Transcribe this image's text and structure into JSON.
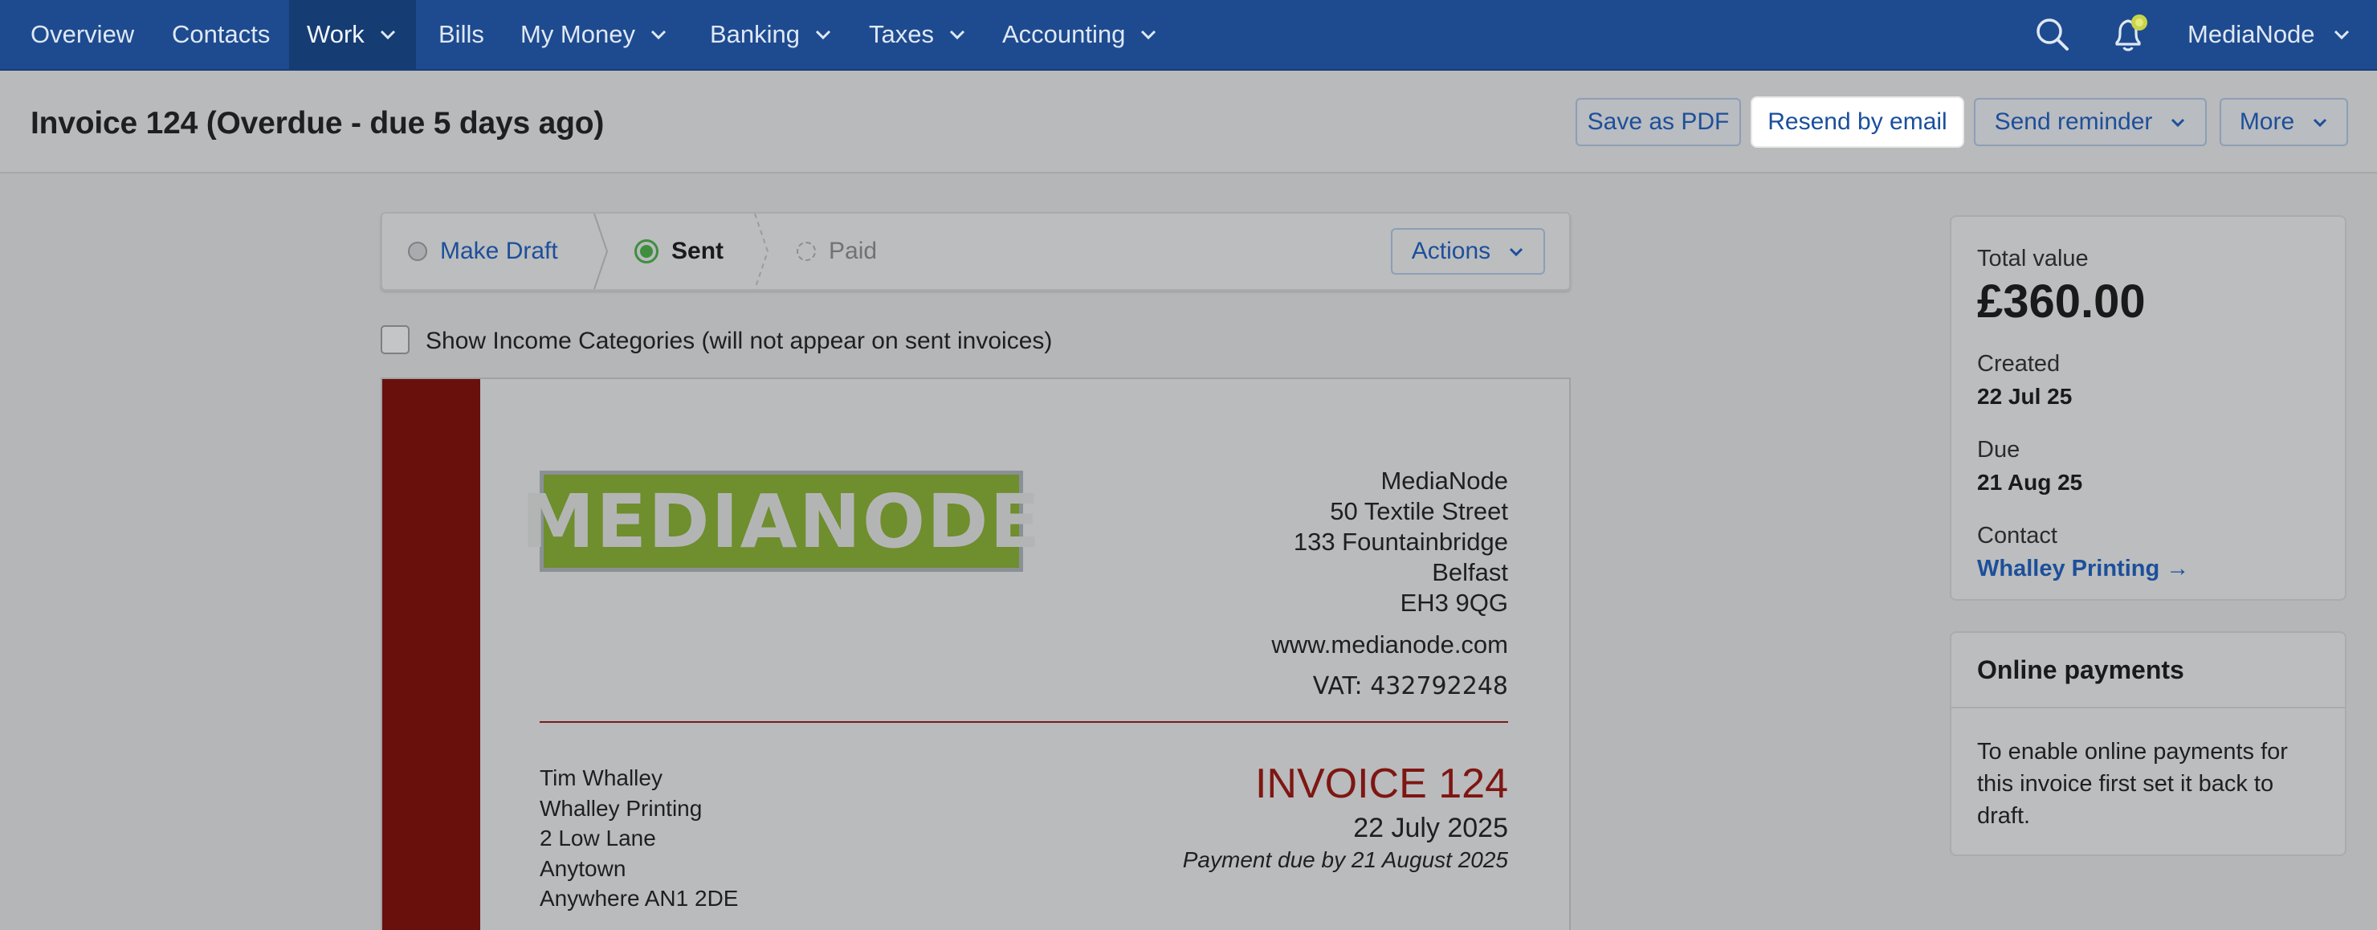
{
  "nav": {
    "items": [
      {
        "label": "Overview"
      },
      {
        "label": "Contacts"
      },
      {
        "label": "Work"
      },
      {
        "label": "Bills"
      },
      {
        "label": "My Money"
      },
      {
        "label": "Banking"
      },
      {
        "label": "Taxes"
      },
      {
        "label": "Accounting"
      }
    ],
    "active": "Work",
    "user": "MediaNode"
  },
  "header": {
    "title": "Invoice 124 (Overdue - due 5 days ago)",
    "buttons": {
      "save_pdf": "Save as PDF",
      "resend": "Resend by email",
      "reminder": "Send reminder",
      "more": "More"
    }
  },
  "status": {
    "steps": {
      "draft": "Make Draft",
      "sent": "Sent",
      "paid": "Paid"
    },
    "actions": "Actions"
  },
  "options": {
    "show_categories": "Show Income Categories (will not appear on sent invoices)"
  },
  "invoice": {
    "logo_text": "MEDIANODE",
    "from": {
      "name": "MediaNode",
      "street": "50 Textile Street",
      "area": "133 Fountainbridge",
      "city": "Belfast",
      "postcode": "EH3 9QG",
      "website": "www.medianode.com",
      "vat": "VAT: 432792248"
    },
    "to": {
      "name": "Tim Whalley",
      "company": "Whalley Printing",
      "street": "2 Low Lane",
      "town": "Anytown",
      "region": "Anywhere AN1 2DE"
    },
    "number": "INVOICE 124",
    "date": "22 July 2025",
    "due": "Payment due by 21 August 2025"
  },
  "summary": {
    "total_label": "Total value",
    "total": "£360.00",
    "created_label": "Created",
    "created": "22 Jul 25",
    "due_label": "Due",
    "due": "21 Aug 25",
    "contact_label": "Contact",
    "contact": "Whalley Printing →"
  },
  "payments": {
    "title": "Online payments",
    "text": "To enable online payments for this invoice first set it back to draft."
  },
  "colors": {
    "nav_bg": "#1e4b8f",
    "link": "#1d4f9a",
    "invoice_accent": "#6a100c",
    "sent_green": "#3e8e3e"
  }
}
